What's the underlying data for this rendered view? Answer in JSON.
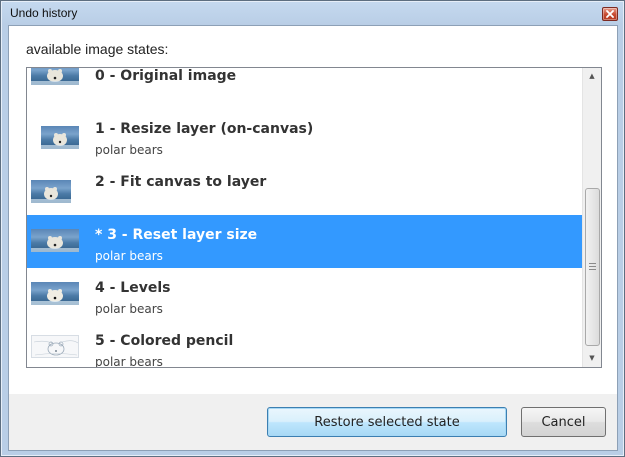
{
  "window": {
    "title": "Undo history"
  },
  "dialog": {
    "prompt": "available image states:",
    "items": [
      {
        "title": "0 - Original image",
        "subtitle": "",
        "thumbnail": "polar-bear-photo",
        "selected": false
      },
      {
        "title": "1 - Resize layer (on-canvas)",
        "subtitle": "polar bears",
        "thumbnail": "polar-bear-photo-small",
        "selected": false
      },
      {
        "title": "2 - Fit canvas to layer",
        "subtitle": "",
        "thumbnail": "polar-bear-photo",
        "selected": false
      },
      {
        "title": "* 3 - Reset layer size",
        "subtitle": "polar bears",
        "thumbnail": "polar-bear-photo",
        "selected": true
      },
      {
        "title": "4 - Levels",
        "subtitle": "polar bears",
        "thumbnail": "polar-bear-photo",
        "selected": false
      },
      {
        "title": "5 - Colored pencil",
        "subtitle": "polar bears",
        "thumbnail": "polar-bear-sketch",
        "selected": false
      }
    ],
    "restore_label": "Restore selected state",
    "cancel_label": "Cancel"
  },
  "colors": {
    "selection": "#3399ff",
    "title_bar": "#c5d9ef",
    "default_button_border": "#3c7fb1"
  }
}
